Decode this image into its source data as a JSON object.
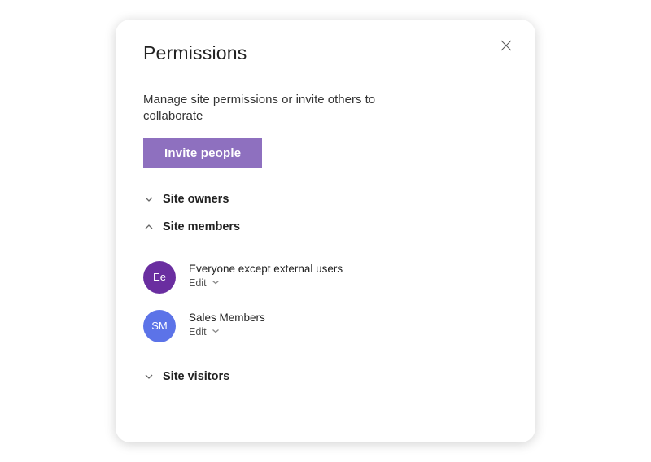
{
  "header": {
    "title": "Permissions",
    "subtitle": "Manage site permissions or invite others to collaborate"
  },
  "actions": {
    "invite_label": "Invite people"
  },
  "sections": {
    "owners": {
      "label": "Site owners",
      "expanded": false
    },
    "members": {
      "label": "Site members",
      "expanded": true,
      "items": [
        {
          "name": "Everyone except external users",
          "initials": "Ee",
          "permission": "Edit",
          "avatar_color": "#6a2ea0"
        },
        {
          "name": "Sales Members",
          "initials": "SM",
          "permission": "Edit",
          "avatar_color": "#5c73e8"
        }
      ]
    },
    "visitors": {
      "label": "Site visitors",
      "expanded": false
    }
  },
  "colors": {
    "accent": "#8e70bf"
  }
}
